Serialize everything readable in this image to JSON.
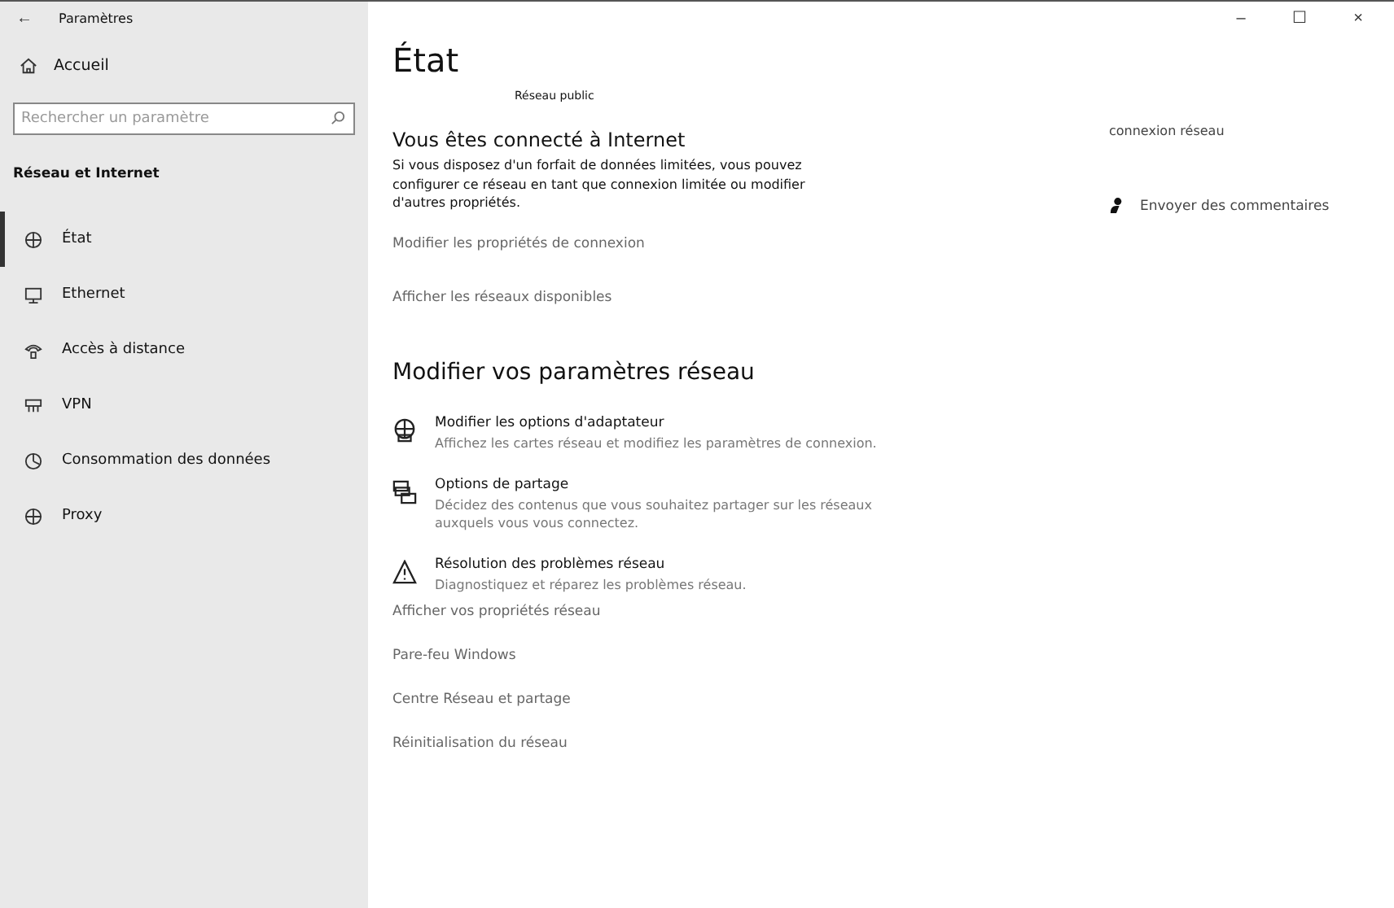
{
  "window": {
    "title": "Paramètres",
    "back": "←",
    "controls": [
      "–",
      "☐",
      "×"
    ]
  },
  "sidebar": {
    "home": "Accueil",
    "search": {
      "placeholder": "Rechercher un paramètre"
    },
    "section": "Réseau et Internet",
    "items": [
      {
        "label": "État",
        "selected": true
      },
      {
        "label": "Ethernet",
        "selected": false
      },
      {
        "label": "Accès à distance",
        "selected": false
      },
      {
        "label": "VPN",
        "selected": false
      },
      {
        "label": "Consommation des données",
        "selected": false
      },
      {
        "label": "Proxy",
        "selected": false
      }
    ]
  },
  "main": {
    "title": "État",
    "network_label": "Réseau public",
    "status_heading": "Vous êtes connecté à Internet",
    "status_text": "Si vous disposez d'un forfait de données limitées, vous pouvez configurer ce réseau en tant que connexion limitée ou modifier d'autres propriétés.",
    "links_top": [
      "Modifier les propriétés de connexion",
      "Afficher les réseaux disponibles"
    ],
    "section_heading": "Modifier vos paramètres réseau",
    "options": [
      {
        "title": "Modifier les options d'adaptateur",
        "description": "Affichez les cartes réseau et modifiez les paramètres de connexion."
      },
      {
        "title": "Options de partage",
        "description": "Décidez des contenus que vous souhaitez partager sur les réseaux auxquels vous vous connectez."
      },
      {
        "title": "Résolution des problèmes réseau",
        "description": "Diagnostiquez et réparez les problèmes réseau."
      }
    ],
    "links_bottom": [
      "Afficher vos propriétés réseau",
      "Pare-feu Windows",
      "Centre Réseau et partage",
      "Réinitialisation du réseau"
    ]
  },
  "aside": {
    "related": "connexion réseau",
    "feedback": "Envoyer des commentaires"
  }
}
